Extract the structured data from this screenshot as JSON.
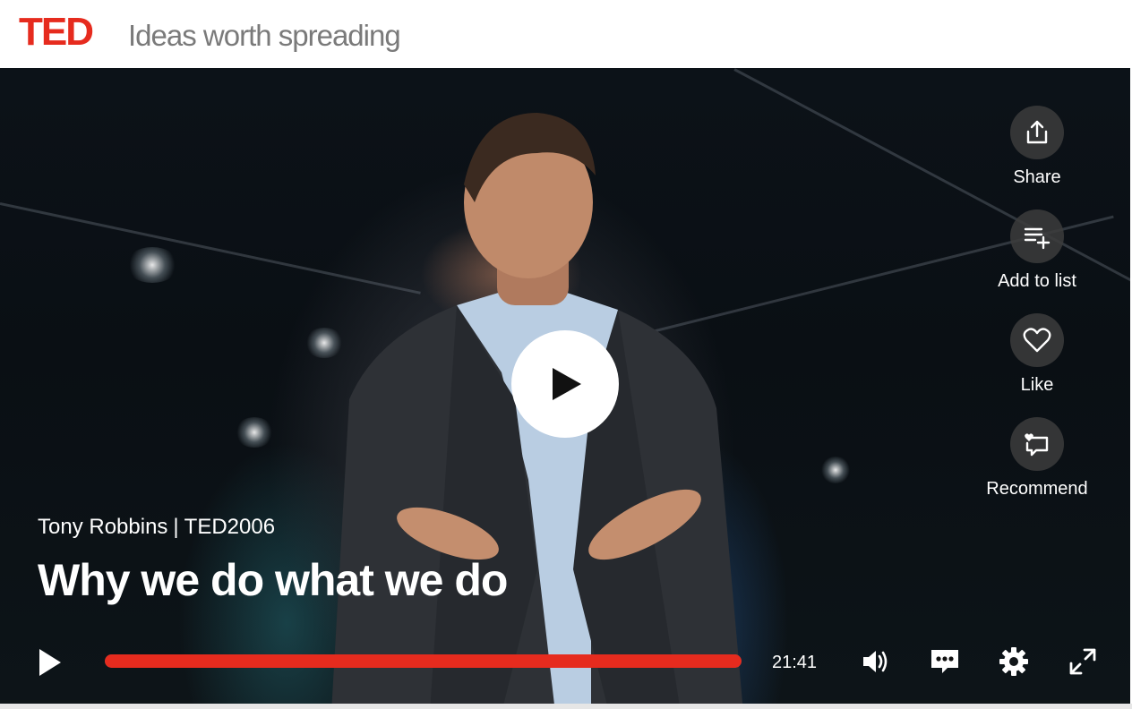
{
  "header": {
    "logo_text": "TED",
    "tagline": "Ideas worth spreading"
  },
  "side_actions": [
    {
      "label": "Share",
      "icon": "share-icon"
    },
    {
      "label": "Add to list",
      "icon": "add-to-list-icon"
    },
    {
      "label": "Like",
      "icon": "heart-icon"
    },
    {
      "label": "Recommend",
      "icon": "recommend-icon"
    }
  ],
  "talk": {
    "speaker": "Tony Robbins",
    "separator": "|",
    "event": "TED2006",
    "title": "Why we do what we do"
  },
  "controls": {
    "duration": "21:41",
    "progress": 1.0,
    "icons": [
      "play-icon",
      "volume-icon",
      "subtitles-icon",
      "settings-icon",
      "fullscreen-icon"
    ]
  },
  "colors": {
    "brand_red": "#e62b1e",
    "tagline_gray": "#7a7a7a"
  }
}
